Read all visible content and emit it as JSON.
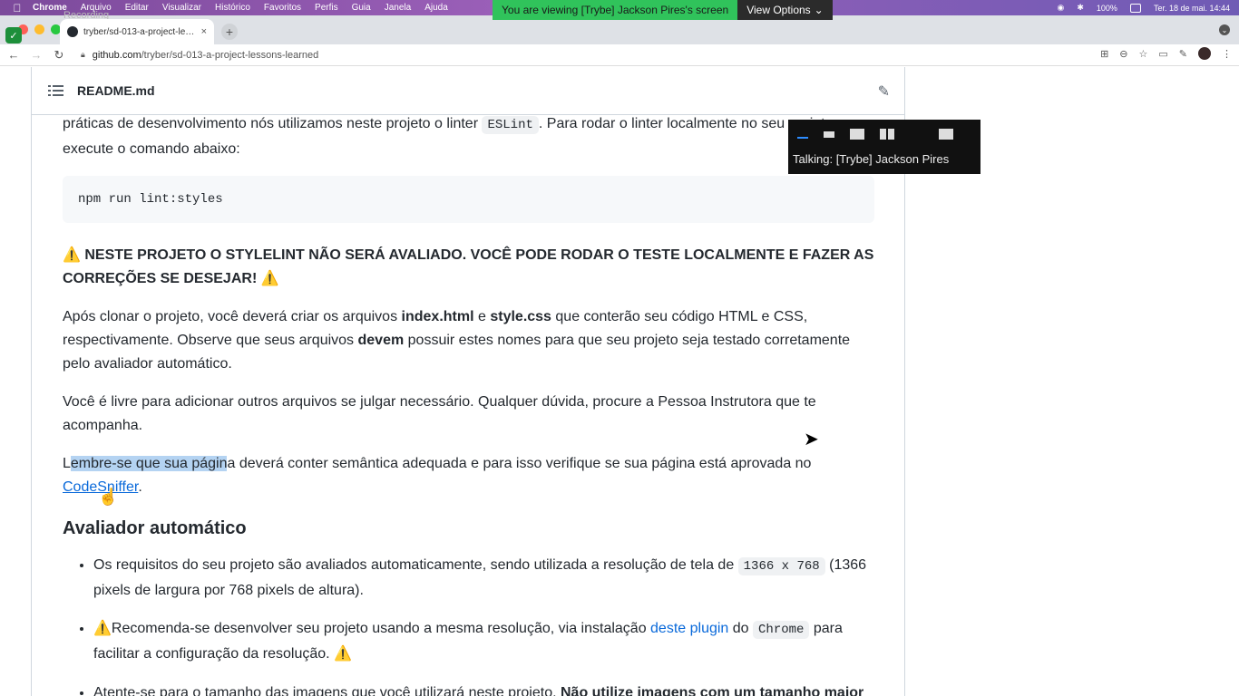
{
  "menubar": {
    "app": "Chrome",
    "items": [
      "Arquivo",
      "Editar",
      "Visualizar",
      "Histórico",
      "Favoritos",
      "Perfis",
      "Guia",
      "Janela",
      "Ajuda"
    ],
    "battery": "100%",
    "datetime": "Ter. 18 de mai.  14:44"
  },
  "share_banner": {
    "text": "You are viewing [Trybe] Jackson Pires's screen",
    "button": "View Options"
  },
  "recording_label": "Recording",
  "tab": {
    "title": "tryber/sd-013-a-project-lesso",
    "close": "×",
    "new_tab": "+"
  },
  "address": {
    "domain": "github.com",
    "path": "/tryber/sd-013-a-project-lessons-learned"
  },
  "readme": {
    "filename": "README.md",
    "p1_a": "práticas de desenvolvimento nós utilizamos neste projeto o linter ",
    "p1_code": "ESLint",
    "p1_b": ". Para rodar o linter localmente no seu projeto, execute o comando abaixo:",
    "code_block": "npm run lint:styles",
    "warning_heading": "NESTE PROJETO O STYLELINT NÃO SERÁ AVALIADO. VOCÊ PODE RODAR O TESTE LOCALMENTE E FAZER AS CORREÇÕES SE DESEJAR!",
    "p2_a": "Após clonar o projeto, você deverá criar os arquivos ",
    "p2_b1": "index.html",
    "p2_c": " e ",
    "p2_b2": "style.css",
    "p2_d": " que conterão seu código HTML e CSS, respectivamente. Observe que seus arquivos ",
    "p2_b3": "devem",
    "p2_e": " possuir estes nomes para que seu projeto seja testado corretamente pelo avaliador automático.",
    "p3": "Você é livre para adicionar outros arquivos se julgar necessário. Qualquer dúvida, procure a Pessoa Instrutora que te acompanha.",
    "p4_a": "L",
    "p4_hl": "embre-se que sua págin",
    "p4_b": "a deverá conter semântica adequada e para isso verifique se sua página está aprovada no ",
    "p4_link": "CodeSniffer",
    "p4_end": ".",
    "h2": "Avaliador automático",
    "li1_a": "Os requisitos do seu projeto são avaliados automaticamente, sendo utilizada a resolução de tela de ",
    "li1_code": "1366 x 768",
    "li1_b": " (1366 pixels de largura por 768 pixels de altura).",
    "li2_a": "Recomenda-se desenvolver seu projeto usando a mesma resolução, via instalação ",
    "li2_link": "deste plugin",
    "li2_b": " do ",
    "li2_code": "Chrome",
    "li2_c": " para facilitar a configuração da resolução.",
    "li3_a": "Atente-se para o tamanho das imagens que você utilizará neste projeto. ",
    "li3_b": "Não utilize imagens com um tamanho maior"
  },
  "call_overlay": {
    "talking": "Talking: [Trybe] Jackson Pires"
  },
  "colors": {
    "link": "#0969da",
    "banner": "#30c35b",
    "selection": "#b4d3f2"
  }
}
